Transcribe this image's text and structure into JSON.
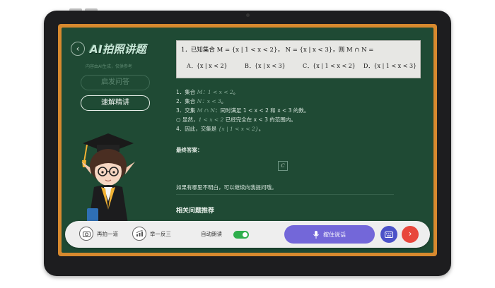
{
  "header": {
    "back_icon": "arrow-left-icon",
    "app_title": "AI拍照讲题",
    "disclaimer": "内容由AI生成，仅供参考"
  },
  "side_buttons": {
    "heuristic": "启发问答",
    "quick_solve": "速解精讲"
  },
  "question": {
    "stem": "1．已知集合 M = {x | 1 < x < 2}， N = {x | x < 3}，则 M ∩ N =",
    "options": [
      {
        "label": "A．",
        "text": "{x | x < 2}"
      },
      {
        "label": "B．",
        "text": "{x | x < 3}"
      },
      {
        "label": "C．",
        "text": "{x | 1 < x < 2}"
      },
      {
        "label": "D．",
        "text": "{x | 1 < x < 3}"
      }
    ]
  },
  "solution": {
    "lines": [
      {
        "prefix": "1．集合 ",
        "math": "M：1 < x < 2",
        "suffix": "。"
      },
      {
        "prefix": "2．集合 ",
        "math": "N：x < 3",
        "suffix": "。"
      },
      {
        "prefix": "3．交集 ",
        "math": "M ∩ N",
        "suffix": "：同时满足  1 < x < 2  和  x < 3  的数。"
      },
      {
        "prefix": "   ○ 显然，",
        "math": "1 < x < 2",
        "suffix": " 已经完全在  x < 3  的范围内。"
      },
      {
        "prefix": "4．因此，交集是 ",
        "math": "{x | 1 < x < 2}",
        "suffix": "。"
      }
    ],
    "final_label": "最终答案：",
    "final_answer": "C",
    "followup": "如果有哪里不明白，可以继续向我提问哦。",
    "related_title": "相关问题推荐"
  },
  "toolbar": {
    "retake_label": "再拍一道",
    "retake_icon": "camera-icon",
    "extend_label": "举一反三",
    "extend_icon": "trend-chart-icon",
    "auto_read_label": "自动朗读",
    "auto_read_on": true,
    "speak_label": "按住说话",
    "speak_icon": "microphone-icon",
    "keyboard_icon": "keyboard-icon",
    "next_icon": "chevron-right-icon"
  },
  "colors": {
    "chalkboard": "#1f4a34",
    "frame": "#d7892e",
    "speak_button": "#7367d9",
    "keyboard_button": "#4b52c8",
    "next_button": "#e8473c",
    "toggle_on": "#2eae4c"
  }
}
